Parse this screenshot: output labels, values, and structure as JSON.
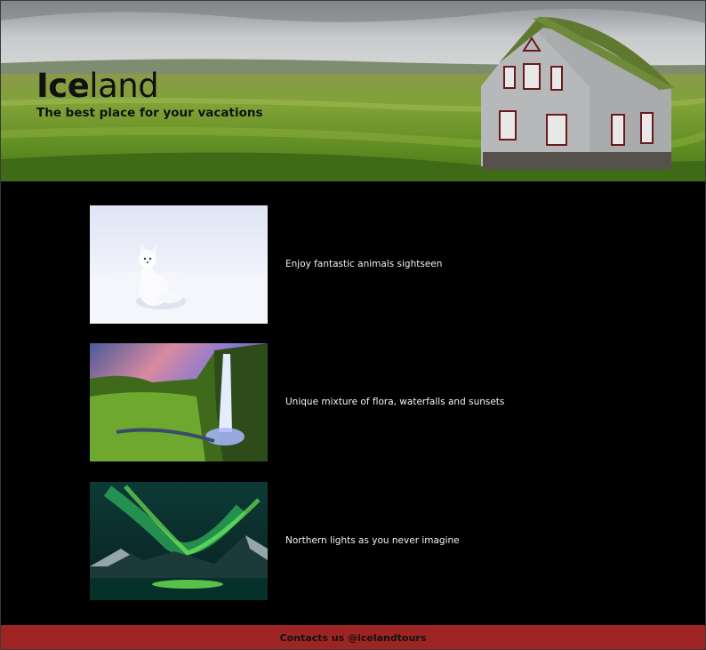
{
  "header": {
    "title_bold": "Ice",
    "title_rest": "land",
    "subtitle": "The best place for your vacations"
  },
  "features": [
    {
      "caption": "Enjoy fantastic animals sightseen",
      "image": "arctic-fox-in-snow"
    },
    {
      "caption": "Unique mixture of flora, waterfalls and sunsets",
      "image": "waterfall-at-sunset"
    },
    {
      "caption": "Northern lights as you never imagine",
      "image": "aurora-over-mountains"
    }
  ],
  "footer": {
    "text": "Contacts us @icelandtours"
  },
  "colors": {
    "background": "#000000",
    "footer": "#9e2424"
  }
}
